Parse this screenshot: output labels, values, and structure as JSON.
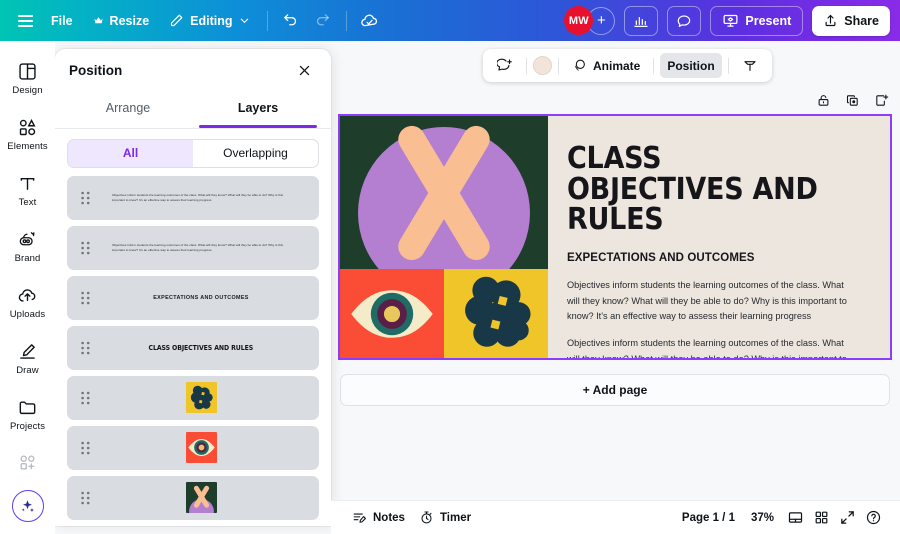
{
  "topbar": {
    "menu_icon": "hamburger-icon",
    "file_label": "File",
    "resize_label": "Resize",
    "resize_icon": "crown-icon",
    "editing_label": "Editing",
    "editing_icon": "pencil-icon",
    "editing_caret": "chevron-down-icon",
    "undo_icon": "undo-icon",
    "redo_icon": "redo-icon",
    "cloud_icon": "cloud-saved-icon",
    "avatar_initials": "MW",
    "avatar_add": "+",
    "insights_icon": "bar-chart-icon",
    "comment_icon": "comment-icon",
    "present_label": "Present",
    "present_icon": "present-screen-icon",
    "share_label": "Share",
    "share_icon": "share-upload-icon",
    "avatar_color": "#e8112d",
    "accent": "#7d2ae8"
  },
  "rail": {
    "items": [
      {
        "label": "Design",
        "icon": "design-icon"
      },
      {
        "label": "Elements",
        "icon": "elements-icon"
      },
      {
        "label": "Text",
        "icon": "text-icon"
      },
      {
        "label": "Brand",
        "icon": "brand-icon"
      },
      {
        "label": "Uploads",
        "icon": "uploads-icon"
      },
      {
        "label": "Draw",
        "icon": "draw-icon"
      },
      {
        "label": "Projects",
        "icon": "projects-icon"
      }
    ],
    "apps_icon": "apps-plus-icon",
    "ai_icon": "magic-sparkle-icon"
  },
  "panel": {
    "title": "Position",
    "close_icon": "close-icon",
    "tabs": [
      {
        "label": "Arrange",
        "active": false
      },
      {
        "label": "Layers",
        "active": true
      }
    ],
    "filters": [
      {
        "label": "All",
        "active": true
      },
      {
        "label": "Overlapping",
        "active": false
      }
    ],
    "layers": [
      {
        "type": "paragraph",
        "text": "Objectives inform students the learning outcomes of the class. What will they know? What will they be able to do? Why is this important to know? It's an effective way to assess their learning progress"
      },
      {
        "type": "paragraph",
        "text": "Objectives inform students the learning outcomes of the class. What will they know? What will they be able to do? Why is this important to know? It's an effective way to assess their learning progress."
      },
      {
        "type": "heading",
        "text": "EXPECTATIONS AND OUTCOMES"
      },
      {
        "type": "title",
        "text": "CLASS OBJECTIVES AND RULES"
      },
      {
        "type": "thumb",
        "text": "",
        "art": "blob-yellow"
      },
      {
        "type": "thumb",
        "text": "",
        "art": "eye-red"
      },
      {
        "type": "thumb",
        "text": "",
        "art": "sticks-green"
      }
    ]
  },
  "floatbar": {
    "comment_icon": "add-comment-icon",
    "color_swatch": "#f2e4d8",
    "animate_label": "Animate",
    "animate_icon": "animate-icon",
    "position_label": "Position",
    "transparency_icon": "transparency-icon"
  },
  "pagetools": {
    "lock_icon": "lock-icon",
    "duplicate_icon": "duplicate-page-icon",
    "addpage_icon": "add-page-icon"
  },
  "slide": {
    "title": "CLASS OBJECTIVES AND RULES",
    "subtitle": "EXPECTATIONS AND OUTCOMES",
    "paragraph1": "Objectives inform students the learning outcomes of the class. What will they know? What will they be able to do? Why is this important to know? It's an effective way to assess their learning progress",
    "paragraph2": "Objectives inform students the learning outcomes of the class. What will they know? What will they be able to do? Why is this important to know? It's an effective way to assess their learning progress.",
    "colors": {
      "background": "#ece6de",
      "dark_green": "#1f3d2b",
      "purple": "#b47fd0",
      "peach": "#f9bf93",
      "red": "#fb4d36",
      "yellow": "#f0c52a",
      "navy": "#183747",
      "cream": "#f4ecc8",
      "selection": "#8b3dff"
    }
  },
  "addpage": {
    "label": "+ Add page"
  },
  "bottombar": {
    "notes_label": "Notes",
    "notes_icon": "notes-icon",
    "timer_label": "Timer",
    "timer_icon": "timer-icon",
    "page_indicator": "Page 1 / 1",
    "zoom_level": "37%",
    "grid_icon": "page-view-icon",
    "thumbnails_icon": "grid-view-icon",
    "fullscreen_icon": "expand-icon",
    "help_icon": "help-icon"
  }
}
